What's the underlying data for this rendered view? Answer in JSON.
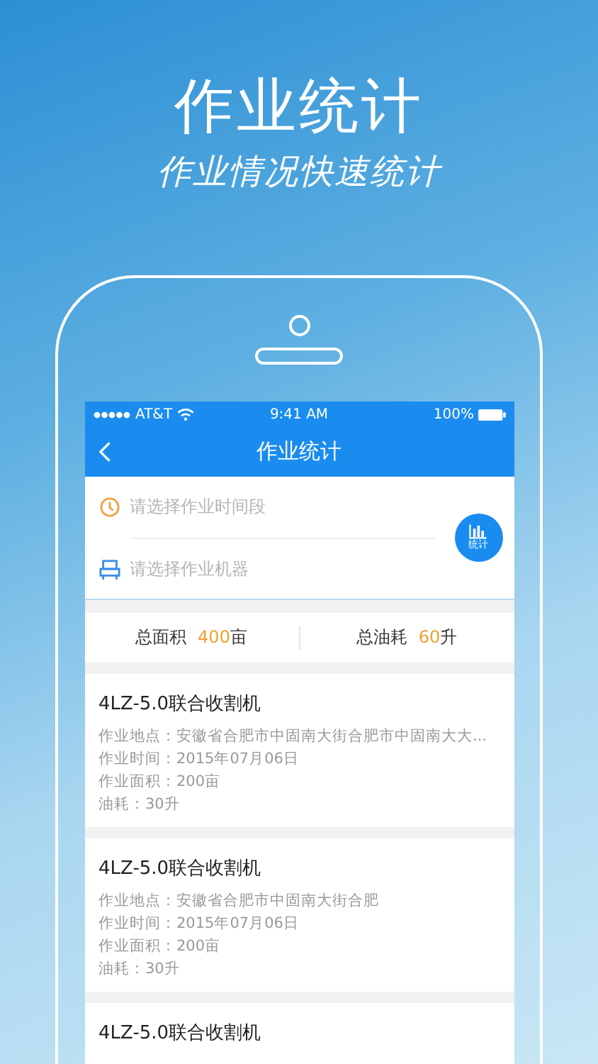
{
  "promo": {
    "title": "作业统计",
    "subtitle": "作业情况快速统计"
  },
  "status_bar": {
    "carrier": "AT&T",
    "time": "9:41 AM",
    "battery": "100%"
  },
  "nav": {
    "title": "作业统计"
  },
  "filters": [
    {
      "kind": "time",
      "placeholder": "请选择作业时间段"
    },
    {
      "kind": "machine",
      "placeholder": "请选择作业机器"
    }
  ],
  "stats_button": {
    "label": "统计"
  },
  "summary": [
    {
      "label": "总面积",
      "value": "400",
      "unit": "亩"
    },
    {
      "label": "总油耗",
      "value": "60",
      "unit": "升"
    }
  ],
  "records": [
    {
      "title": "4LZ-5.0联合收割机",
      "details": [
        "作业地点：安徽省合肥市中固南大街合肥市中固南大大...",
        "作业时间：2015年07月06日",
        "作业面积：200亩",
        "油耗：30升"
      ]
    },
    {
      "title": "4LZ-5.0联合收割机",
      "details": [
        "作业地点：安徽省合肥市中固南大街合肥",
        "作业时间：2015年07月06日",
        "作业面积：200亩",
        "油耗：30升"
      ]
    },
    {
      "title": "4LZ-5.0联合收割机"
    }
  ]
}
